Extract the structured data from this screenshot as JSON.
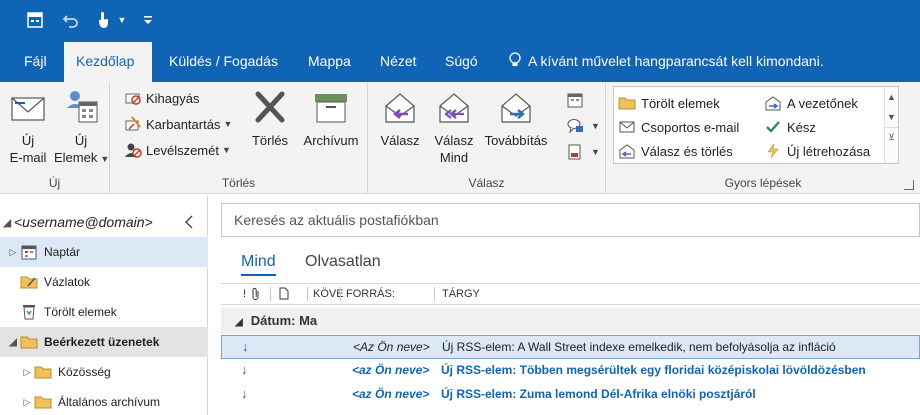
{
  "quick_access": {
    "app_icon": "outlook-calendar-icon",
    "undo_icon": "undo-icon",
    "touch_icon": "touch-mode-icon",
    "customize_icon": "customize-qat-icon"
  },
  "menu": {
    "tabs": [
      {
        "label": "Fájl"
      },
      {
        "label": "Kezdőlap"
      },
      {
        "label": "Küldés / Fogadás"
      },
      {
        "label": "Mappa"
      },
      {
        "label": "Nézet"
      },
      {
        "label": "Súgó"
      }
    ],
    "active_tab": "Kezdőlap",
    "tell_me": "A kívánt művelet hangparancsát kell kimondani."
  },
  "ribbon": {
    "groups": {
      "new": {
        "label": "Új",
        "new_email_line1": "Új",
        "new_email_line2": "E-mail",
        "new_items_line1": "Új",
        "new_items_line2": "Elemek"
      },
      "delete": {
        "label": "Törlés",
        "ignore": "Kihagyás",
        "cleanup": "Karbantartás",
        "junk": "Levélszemét",
        "delete_btn": "Törlés",
        "archive_btn": "Archívum"
      },
      "respond": {
        "label": "Válasz",
        "reply": "Válasz",
        "reply_all_line1": "Válasz",
        "reply_all_line2": "Mind",
        "forward": "Továbbítás"
      },
      "quick_steps": {
        "label": "Gyors lépések",
        "items": [
          {
            "label": "Törölt elemek"
          },
          {
            "label": "Csoportos e-mail"
          },
          {
            "label": "Válasz és törlés"
          },
          {
            "label": "A vezetőnek"
          },
          {
            "label": "Kész"
          },
          {
            "label": "Új létrehozása"
          }
        ]
      }
    }
  },
  "nav": {
    "account": "<username@domain>",
    "items": [
      {
        "label": "Naptár"
      },
      {
        "label": "Vázlatok"
      },
      {
        "label": "Törölt elemek"
      },
      {
        "label": "Beérkezett üzenetek"
      },
      {
        "label": "Közösség"
      },
      {
        "label": "Általános archívum"
      }
    ]
  },
  "mail": {
    "search_placeholder": "Keresés az aktuális postafiókban",
    "filter_all": "Mind",
    "filter_unread": "Olvasatlan",
    "columns": {
      "importance": "!",
      "attachment_icon": "attachment-icon",
      "document_icon": "document-icon",
      "category": "KÖVE",
      "from": "FORRÁS:",
      "subject": "TÁRGY"
    },
    "group_header": "Dátum: Ma",
    "messages": [
      {
        "from": "<Az Ön neve>",
        "subject": "Új RSS-elem: A Wall Street indexe emelkedik, nem befolyásolja az infláció",
        "unread": false
      },
      {
        "from": "<az Ön neve>",
        "subject": "Új RSS-elem: Többen megsérültek egy floridai középiskolai lövöldözésben",
        "unread": true
      },
      {
        "from": "<az Ön neve>",
        "subject": "Új RSS-elem: Zuma lemond Dél-Afrika elnöki posztjáról",
        "unread": true
      }
    ]
  },
  "colors": {
    "brand_blue": "#0f64b6",
    "ribbon_bg": "#f3f3f3",
    "selection_bg": "#dce8f5",
    "archive_green": "#6b8e5e",
    "reply_purple": "#7b4fb8"
  }
}
